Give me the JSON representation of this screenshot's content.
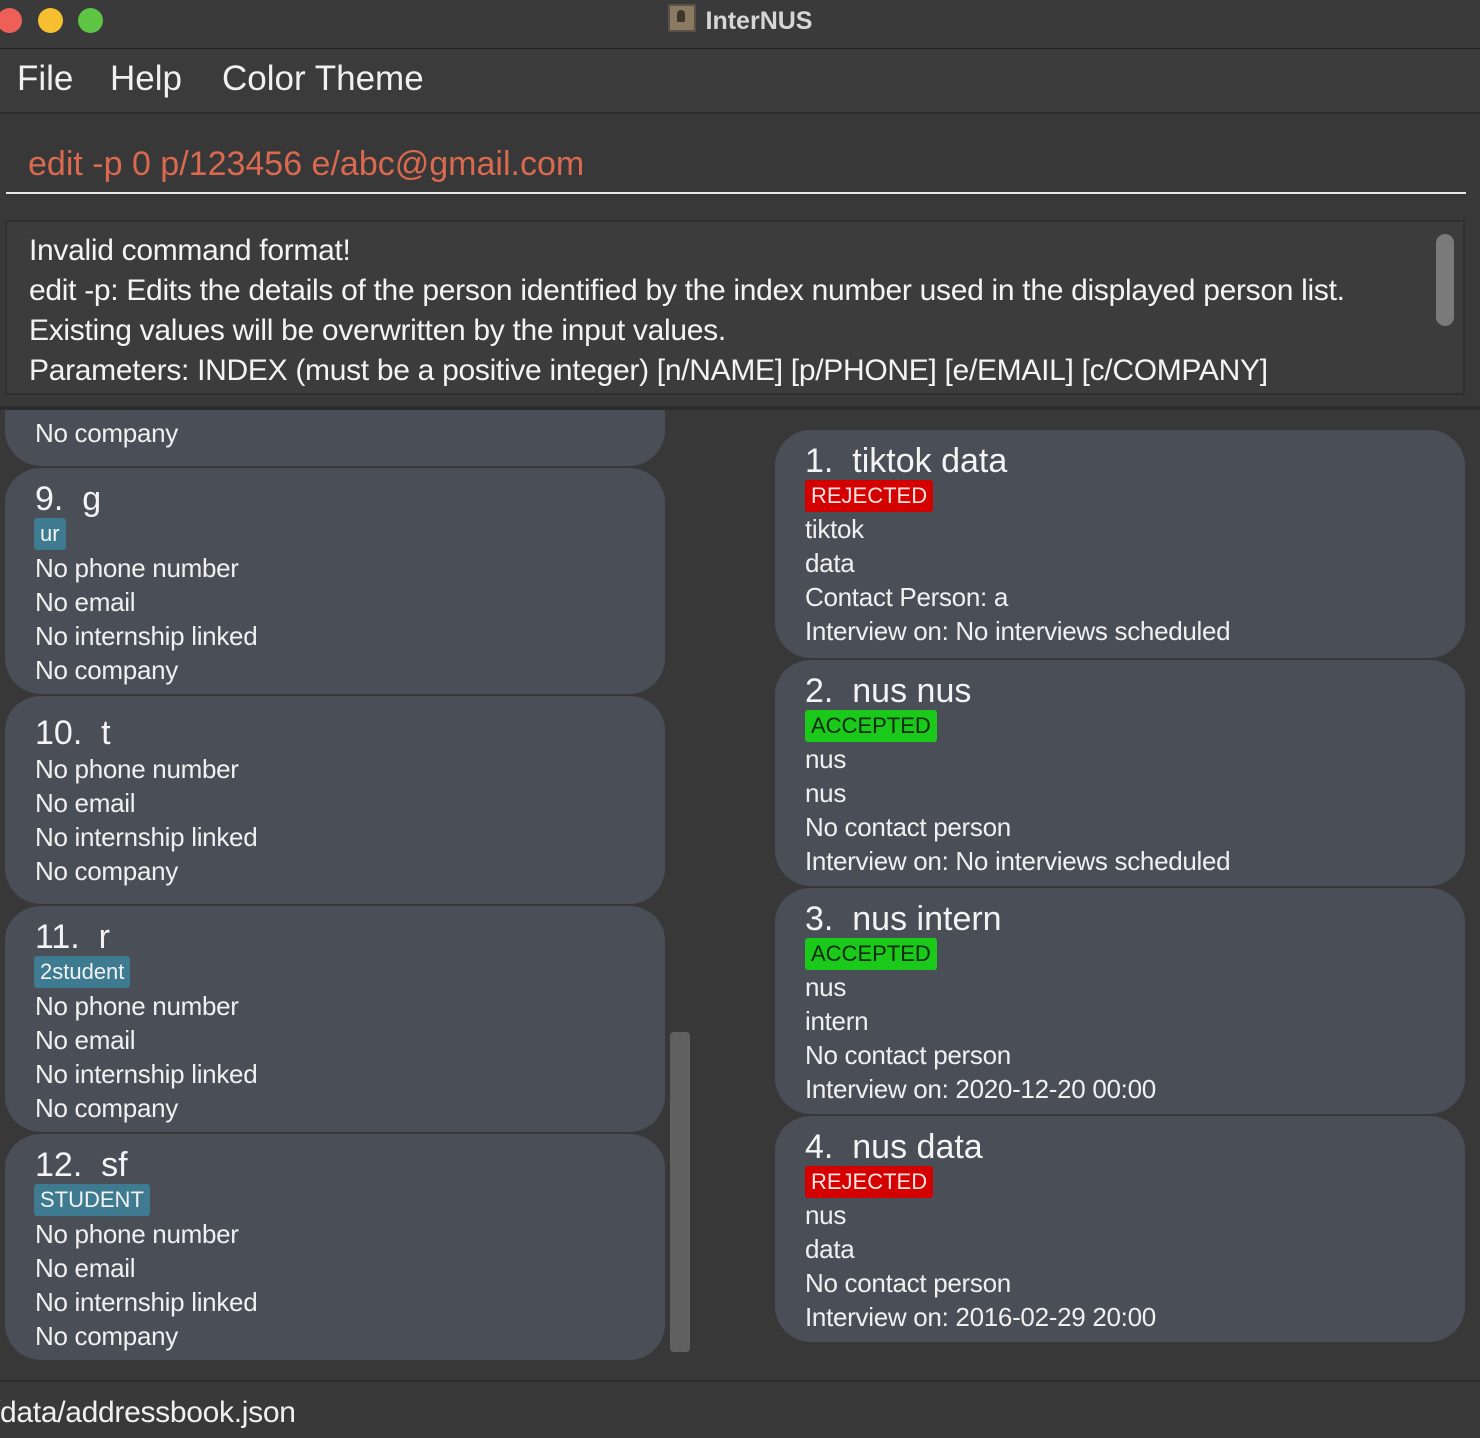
{
  "window": {
    "title": "InterNUS",
    "app_icon": "contacts-app-icon"
  },
  "menu": {
    "items": [
      "File",
      "Help",
      "Color Theme"
    ]
  },
  "command_box": {
    "value": "edit -p 0 p/123456 e/abc@gmail.com",
    "text_color": "#d9694f"
  },
  "result_display": {
    "lines": [
      "Invalid command format!",
      "edit -p: Edits the details of the person identified by the index number used in the displayed person list.",
      "Existing values will be overwritten by the input values.",
      "Parameters: INDEX (must be a positive integer) [n/NAME] [p/PHONE] [e/EMAIL] [c/COMPANY]"
    ]
  },
  "person_list": {
    "partial_top_line": "No company",
    "cards": [
      {
        "index": "9.",
        "name": "g",
        "tag": "ur",
        "phone": "No phone number",
        "email": "No email",
        "internship": "No internship linked",
        "company": "No company"
      },
      {
        "index": "10.",
        "name": "t",
        "tag": "",
        "phone": "No phone number",
        "email": "No email",
        "internship": "No internship linked",
        "company": "No company"
      },
      {
        "index": "11.",
        "name": "r",
        "tag": "2student",
        "phone": "No phone number",
        "email": "No email",
        "internship": "No internship linked",
        "company": "No company"
      },
      {
        "index": "12.",
        "name": "sf",
        "tag": "STUDENT",
        "phone": "No phone number",
        "email": "No email",
        "internship": "No internship linked",
        "company": "No company"
      }
    ]
  },
  "internship_list": {
    "cards": [
      {
        "index": "1.",
        "title": "tiktok data",
        "status": "REJECTED",
        "company": "tiktok",
        "role": "data",
        "contact": "Contact Person: a",
        "interview": "Interview on: No interviews scheduled"
      },
      {
        "index": "2.",
        "title": "nus nus",
        "status": "ACCEPTED",
        "company": "nus",
        "role": "nus",
        "contact": "No contact person",
        "interview": "Interview on: No interviews scheduled"
      },
      {
        "index": "3.",
        "title": "nus intern",
        "status": "ACCEPTED",
        "company": "nus",
        "role": "intern",
        "contact": "No contact person",
        "interview": "Interview on: 2020-12-20 00:00"
      },
      {
        "index": "4.",
        "title": "nus data",
        "status": "REJECTED",
        "company": "nus",
        "role": "data",
        "contact": "No contact person",
        "interview": "Interview on: 2016-02-29 20:00"
      }
    ]
  },
  "status_bar": {
    "path": "/data/addressbook.json"
  },
  "colors": {
    "rejected": "#d40000",
    "accepted": "#1ac91a",
    "person_tag": "#3e7b91",
    "card": "#4a4e57",
    "background": "#383838"
  }
}
